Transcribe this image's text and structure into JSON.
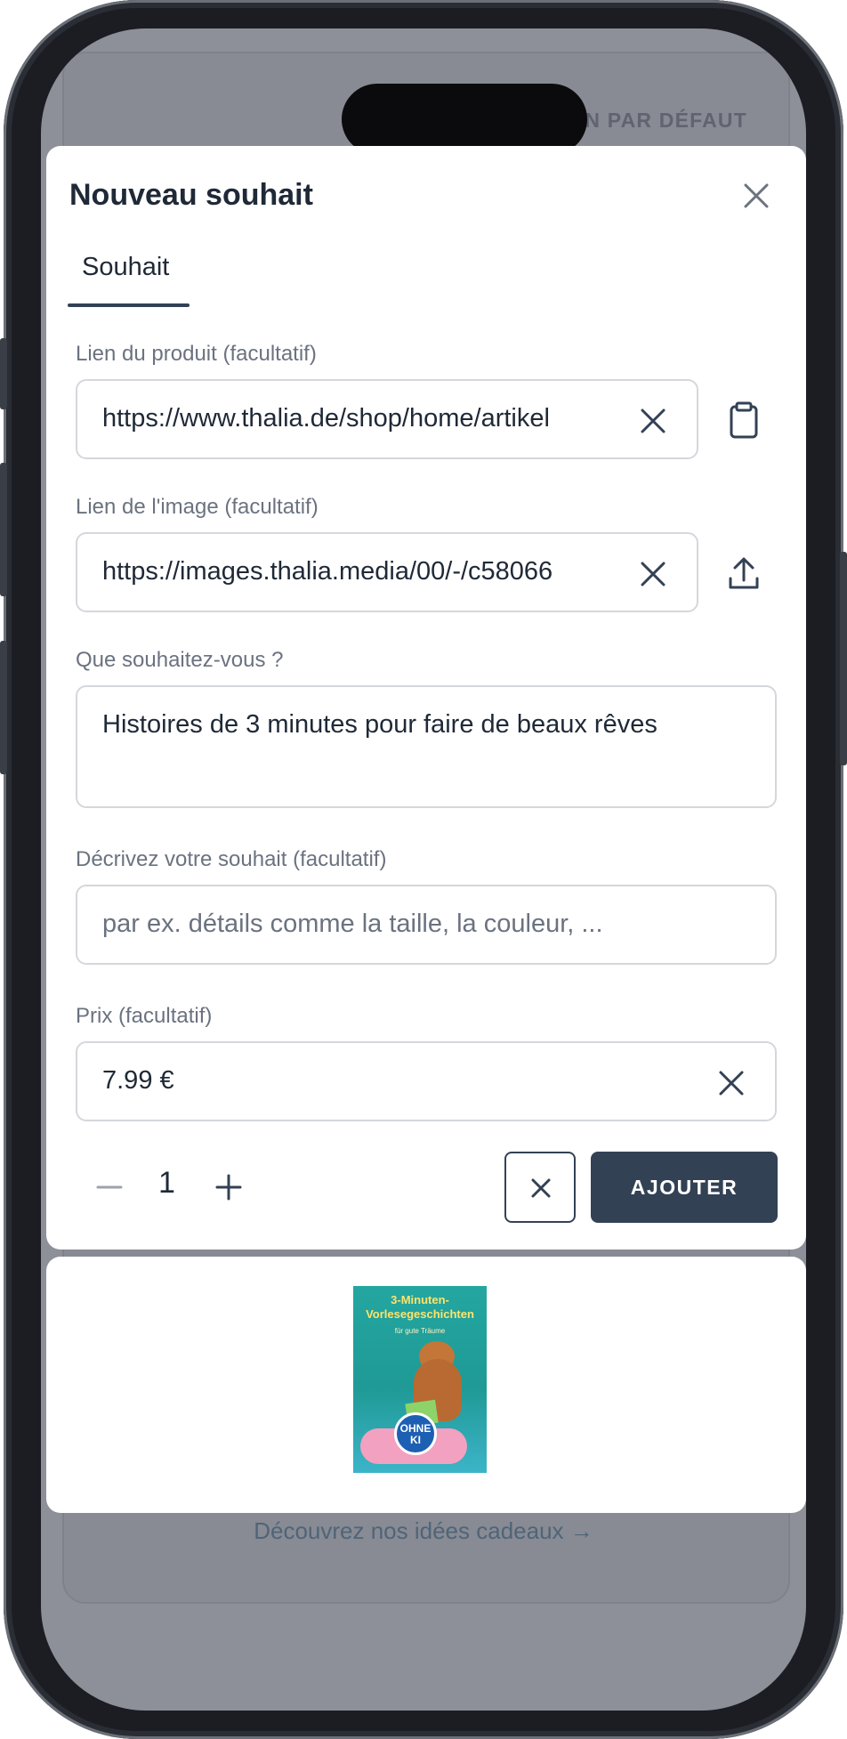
{
  "background": {
    "header_label": "DESIGN PAR DÉFAUT",
    "gift_ideas_link": "Découvrez nos idées cadeaux →"
  },
  "modal": {
    "title": "Nouveau souhait",
    "close_icon": "close-icon",
    "tabs": [
      {
        "label": "Souhait",
        "active": true
      }
    ],
    "product_link": {
      "label": "Lien du produit (facultatif)",
      "value": "https://www.thalia.de/shop/home/artikel",
      "side_icon": "clipboard-icon"
    },
    "image_link": {
      "label": "Lien de l'image (facultatif)",
      "value": "https://images.thalia.media/00/-/c58066",
      "side_icon": "upload-icon"
    },
    "wish": {
      "label": "Que souhaitez-vous ?",
      "value": "Histoires de 3 minutes pour faire de beaux rêves"
    },
    "description": {
      "label": "Décrivez votre souhait (facultatif)",
      "placeholder": "par ex. détails comme la taille, la couleur, ..."
    },
    "price": {
      "label": "Prix (facultatif)",
      "value": "7.99 €"
    },
    "quantity": "1",
    "add_button": "AJOUTER"
  },
  "preview": {
    "book_title": "3-Minuten-Vorlesegeschichten",
    "book_subtitle": "für gute Träume",
    "badge": "OHNE KI"
  },
  "colors": {
    "primary": "#334155",
    "overlay": "#8d9099",
    "border": "#d4d7dc"
  }
}
